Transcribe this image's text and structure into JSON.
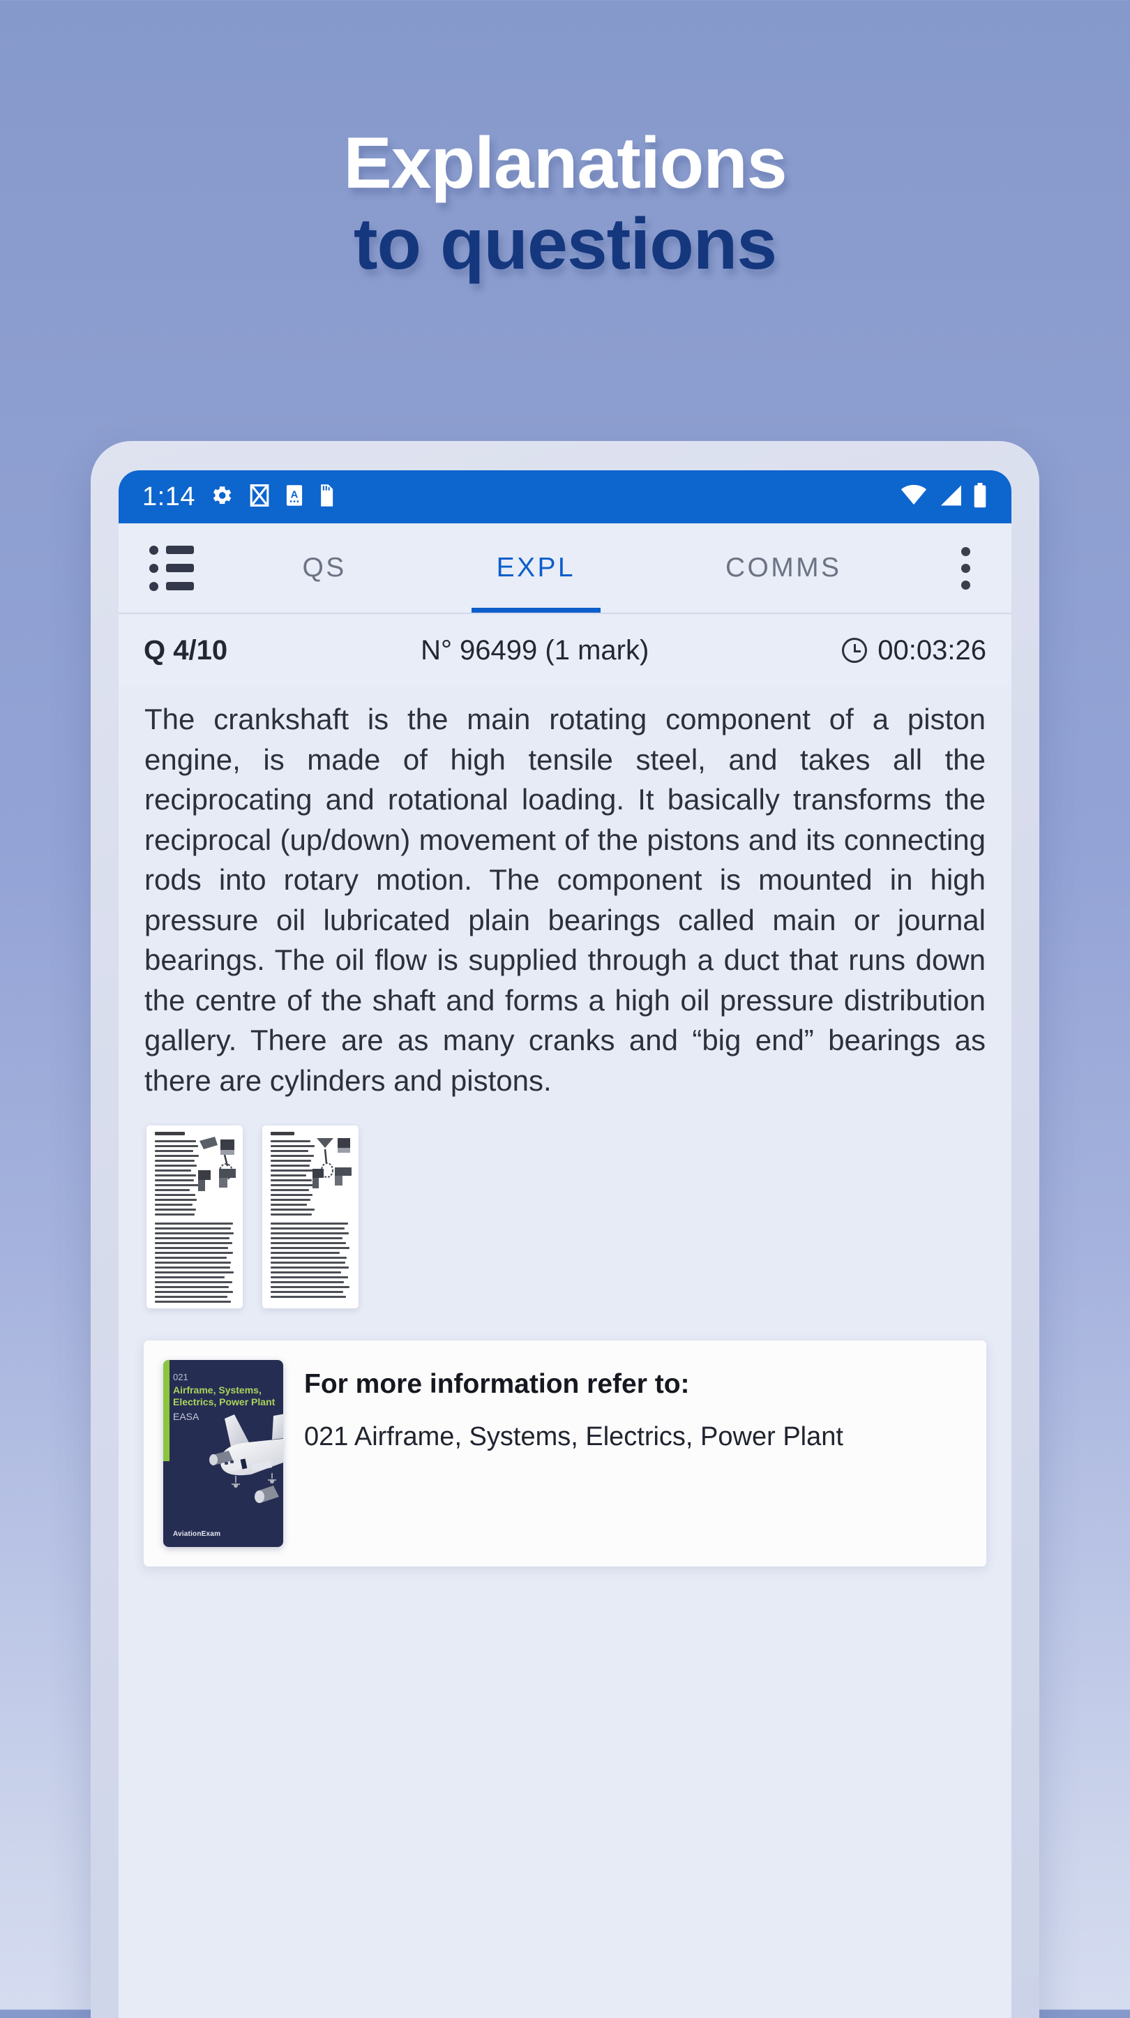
{
  "promo": {
    "headline_line1": "Explanations",
    "headline_line2": "to questions",
    "headline_color_primary": "#ffffff",
    "headline_color_secondary": "#15377e",
    "background_top": "#8699cb",
    "background_bottom": "#d5dcf0"
  },
  "statusbar": {
    "time": "1:14",
    "accent": "#0d65ce",
    "left_icons": [
      "gear-icon",
      "crossed-box-icon",
      "a-box-icon",
      "sd-card-icon"
    ],
    "right_icons": [
      "wifi-icon",
      "signal-icon",
      "battery-icon"
    ]
  },
  "appbar": {
    "menu_icon": "list-icon",
    "overflow_icon": "more-vertical-icon",
    "active_tab": "EXPL",
    "active_color": "#0d5ecb",
    "tabs": [
      {
        "label": "QS",
        "active": false
      },
      {
        "label": "EXPL",
        "active": true
      },
      {
        "label": "COMMS",
        "active": false
      }
    ]
  },
  "question_info": {
    "counter": "Q 4/10",
    "number": "N° 96499 (1 mark)",
    "timer": "00:03:26",
    "timer_icon": "clock-icon"
  },
  "explanation": {
    "text": "The crankshaft is the main rotating component of a piston engine, is made of high tensile steel, and takes all the reciprocating and rotational loading. It basically transforms the reciprocal (up/down) movement of the pistons and its connecting rods into rotary motion. The component is mounted in high pressure oil lubricated plain bearings called main or journal bearings. The oil flow is supplied through a duct that runs down the centre of the shaft and forms a high oil pressure distribution gallery. There are as many cranks and “big end” bearings as there are cylinders and pistons."
  },
  "attachments": [
    {
      "name": "scanned-page-thumbnail-1"
    },
    {
      "name": "scanned-page-thumbnail-2"
    }
  ],
  "reference_card": {
    "heading": "For more information refer to:",
    "reference": "021 Airframe, Systems, Electrics, Power Plant",
    "book": {
      "code": "021",
      "title": "Airframe, Systems, Electrics, Power Plant",
      "org": "EASA",
      "brand": "AviationExam",
      "cover_color": "#262d52",
      "accent_color": "#8cc63f"
    }
  }
}
